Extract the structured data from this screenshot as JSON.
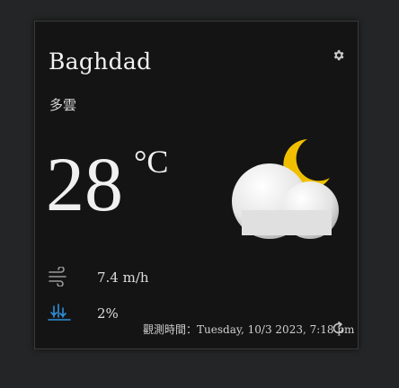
{
  "card": {
    "city": "Baghdad",
    "condition": "多雲",
    "temperature": "28",
    "unit": "°C",
    "wind": "7.4 m/h",
    "humidity": "2%",
    "observation_label": "觀測時間：",
    "observation_time": "Tuesday, 10/3 2023, 7:18 pm"
  },
  "icons": {
    "settings": "gear-icon",
    "weather": "partly-cloudy-night-icon",
    "wind": "wind-icon",
    "humidity": "humidity-icon",
    "refresh": "refresh-icon"
  },
  "colors": {
    "background": "#242526",
    "card": "#141414",
    "accent_blue": "#2f8fd8",
    "moon": "#f2c200"
  }
}
